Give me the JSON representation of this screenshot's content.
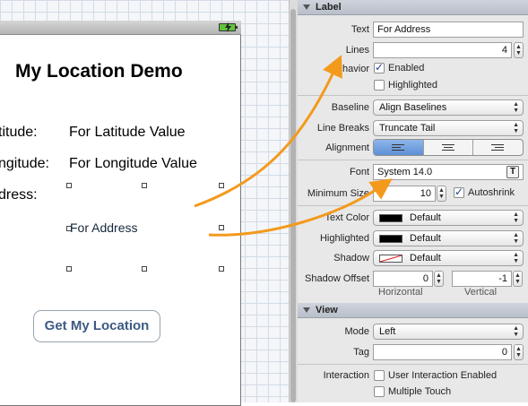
{
  "canvas": {
    "app_title": "My Location Demo",
    "latitude_label": "titude:",
    "latitude_value": "For Latitude Value",
    "longitude_label": "ngitude:",
    "longitude_value": "For Longitude Value",
    "address_label": "dress:",
    "address_value": "For Address",
    "button_label": "Get My Location"
  },
  "inspector": {
    "label_section": {
      "title": "Label",
      "text_label": "Text",
      "text_value": "For Address",
      "lines_label": "Lines",
      "lines_value": "4",
      "behavior_label": "Behavior",
      "enabled_label": "Enabled",
      "enabled_checked": true,
      "highlighted_label": "Highlighted",
      "highlighted_checked": false,
      "baseline_label": "Baseline",
      "baseline_value": "Align Baselines",
      "linebreaks_label": "Line Breaks",
      "linebreaks_value": "Truncate Tail",
      "alignment_label": "Alignment",
      "alignment_selected": "left",
      "font_label": "Font",
      "font_value": "System 14.0",
      "minsize_label": "Minimum Size",
      "minsize_value": "10",
      "autoshrink_label": "Autoshrink",
      "autoshrink_checked": true,
      "textcolor_label": "Text Color",
      "textcolor_value": "Default",
      "highlighted_color_label": "Highlighted",
      "highlighted_color_value": "Default",
      "shadow_label": "Shadow",
      "shadow_value": "Default",
      "shadow_offset_label": "Shadow Offset",
      "shadow_offset_h": "0",
      "shadow_offset_v": "-1",
      "horizontal_label": "Horizontal",
      "vertical_label": "Vertical"
    },
    "view_section": {
      "title": "View",
      "mode_label": "Mode",
      "mode_value": "Left",
      "tag_label": "Tag",
      "tag_value": "0",
      "interaction_label": "Interaction",
      "user_interaction_label": "User Interaction Enabled",
      "user_interaction_checked": false,
      "multiple_touch_label": "Multiple Touch",
      "multiple_touch_checked": false
    }
  },
  "colors": {
    "arrow": "#f39a1d",
    "accent_selected": "#5d8fd6",
    "battery": "#5fc43a"
  }
}
